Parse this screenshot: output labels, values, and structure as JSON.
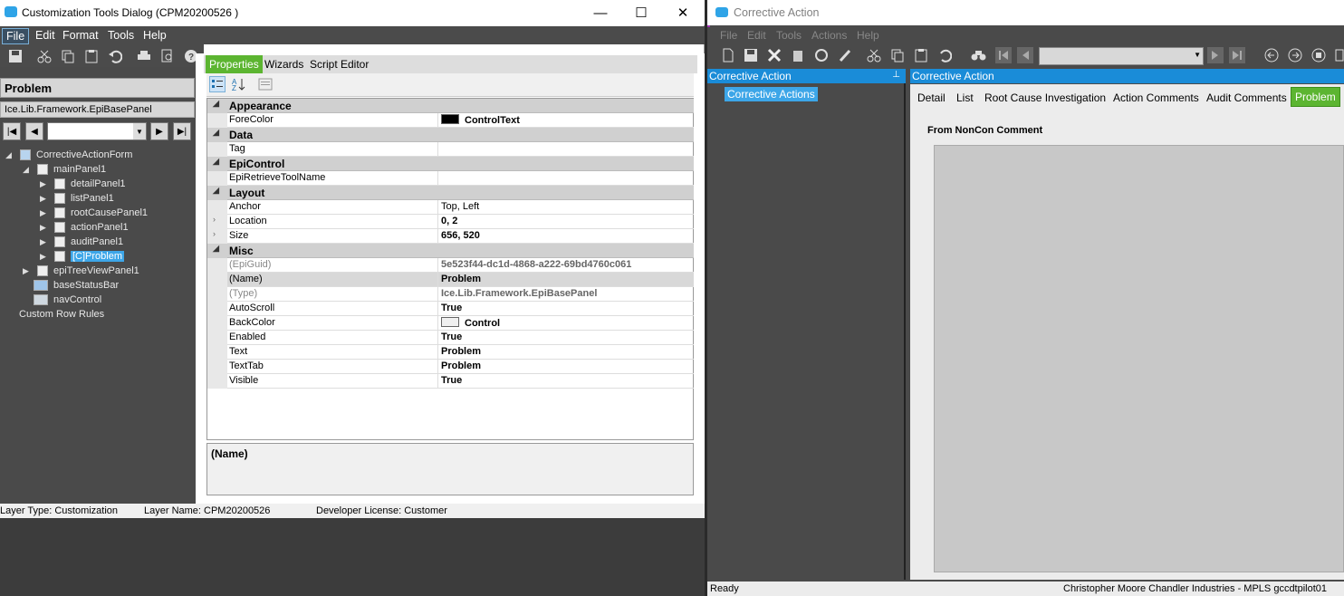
{
  "dialog": {
    "title": "Customization Tools Dialog  (CPM20200526 )",
    "menu": [
      "File",
      "Edit",
      "Format",
      "Tools",
      "Help"
    ],
    "panel_title": "Problem",
    "class_name": "Ice.Lib.Framework.EpiBasePanel",
    "tree": [
      {
        "label": "CorrectiveActionForm"
      },
      {
        "label": "mainPanel1"
      },
      {
        "label": "detailPanel1"
      },
      {
        "label": "listPanel1"
      },
      {
        "label": "rootCausePanel1"
      },
      {
        "label": "actionPanel1"
      },
      {
        "label": "auditPanel1"
      },
      {
        "label": "[C]Problem"
      },
      {
        "label": "epiTreeViewPanel1"
      },
      {
        "label": "baseStatusBar"
      },
      {
        "label": "navControl"
      },
      {
        "label": "Custom Row Rules"
      }
    ],
    "tabs": [
      "Properties",
      "Wizards",
      "Script Editor"
    ],
    "properties": [
      {
        "cat": "Appearance"
      },
      {
        "name": "ForeColor",
        "value": "ControlText",
        "swatch": "#000000",
        "bold": true
      },
      {
        "cat": "Data"
      },
      {
        "name": "Tag",
        "value": ""
      },
      {
        "cat": "EpiControl"
      },
      {
        "name": "EpiRetrieveToolName",
        "value": ""
      },
      {
        "cat": "Layout"
      },
      {
        "name": "Anchor",
        "value": "Top, Left"
      },
      {
        "name": "Location",
        "value": "0, 2",
        "expand": true,
        "bold": true
      },
      {
        "name": "Size",
        "value": "656, 520",
        "expand": true,
        "bold": true
      },
      {
        "cat": "Misc"
      },
      {
        "name": "(EpiGuid)",
        "value": "5e523f44-dc1d-4868-a222-69bd4760c061",
        "grey": true,
        "bold": true
      },
      {
        "name": "(Name)",
        "value": "Problem",
        "bold": true
      },
      {
        "name": "(Type)",
        "value": "Ice.Lib.Framework.EpiBasePanel",
        "grey": true,
        "bold": true
      },
      {
        "name": "AutoScroll",
        "value": "True",
        "bold": true
      },
      {
        "name": "BackColor",
        "value": "Control",
        "swatch": "#f0f0f0",
        "bold": true
      },
      {
        "name": "Enabled",
        "value": "True",
        "bold": true
      },
      {
        "name": "Text",
        "value": "Problem",
        "bold": true
      },
      {
        "name": "TextTab",
        "value": "Problem",
        "bold": true
      },
      {
        "name": "Visible",
        "value": "True",
        "bold": true
      }
    ],
    "description_title": "(Name)",
    "status": {
      "layer_type": "Layer Type:  Customization",
      "layer_name": "Layer Name:  CPM20200526",
      "license": "Developer License:  Customer"
    }
  },
  "ca_window": {
    "title": "Corrective Action",
    "menu": [
      "File",
      "Edit",
      "Tools",
      "Actions",
      "Help"
    ],
    "left_header": "Corrective Action",
    "tree_item": "Corrective Actions",
    "right_header": "Corrective Action",
    "tabs": [
      "Detail",
      "List",
      "Root Cause Investigation",
      "Action Comments",
      "Audit Comments",
      "Problem"
    ],
    "field_label": "From NonCon Comment",
    "status_left": "Ready",
    "status_right": "Christopher Moore  Chandler Industries - MPLS  gccdtpilot01"
  },
  "colors": {
    "accent_green": "#5cb531",
    "accent_blue": "#1a8cd8"
  }
}
